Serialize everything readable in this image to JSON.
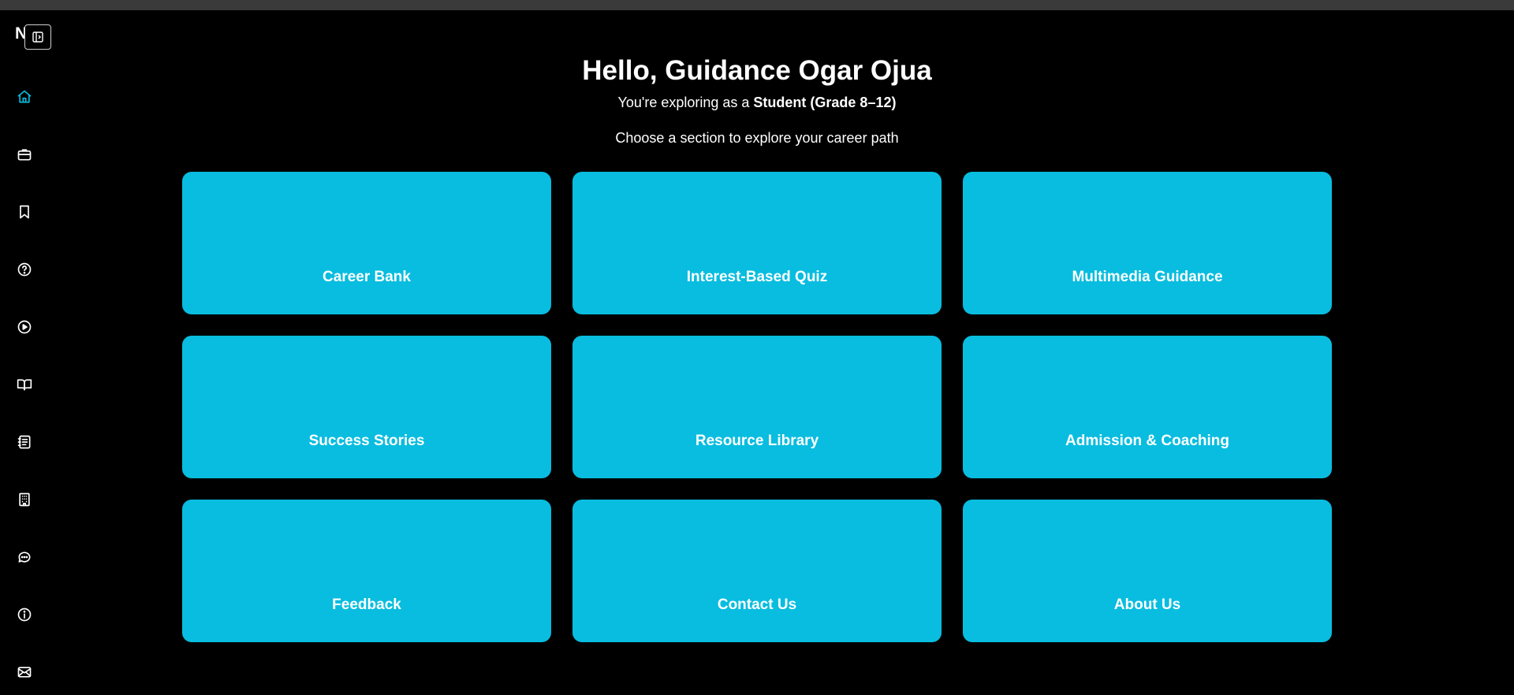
{
  "app": {
    "brand": "NS",
    "accent_color": "#08bddf"
  },
  "sidebar": {
    "collapse_icon": "collapse-sidebar-icon",
    "items": [
      {
        "name": "home",
        "icon": "home-icon",
        "active": true
      },
      {
        "name": "career-bank",
        "icon": "briefcase-icon",
        "active": false
      },
      {
        "name": "bookmarks",
        "icon": "bookmark-icon",
        "active": false
      },
      {
        "name": "quiz",
        "icon": "question-circle-icon",
        "active": false
      },
      {
        "name": "multimedia",
        "icon": "play-circle-icon",
        "active": false
      },
      {
        "name": "library",
        "icon": "book-open-icon",
        "active": false
      },
      {
        "name": "success-stories",
        "icon": "notebook-icon",
        "active": false
      },
      {
        "name": "admission",
        "icon": "building-icon",
        "active": false
      },
      {
        "name": "feedback",
        "icon": "chat-bubble-icon",
        "active": false
      },
      {
        "name": "about",
        "icon": "info-circle-icon",
        "active": false
      },
      {
        "name": "contact",
        "icon": "mail-icon",
        "active": false
      }
    ]
  },
  "main": {
    "greeting": "Hello, Guidance Ogar Ojua",
    "role_prefix": "You're exploring as a ",
    "role": "Student (Grade 8–12)",
    "subtitle": "Choose a section to explore your career path",
    "cards": [
      {
        "label": "Career Bank"
      },
      {
        "label": "Interest-Based Quiz"
      },
      {
        "label": "Multimedia Guidance"
      },
      {
        "label": "Success Stories"
      },
      {
        "label": "Resource Library"
      },
      {
        "label": "Admission & Coaching"
      },
      {
        "label": "Feedback"
      },
      {
        "label": "Contact Us"
      },
      {
        "label": "About Us"
      }
    ]
  }
}
